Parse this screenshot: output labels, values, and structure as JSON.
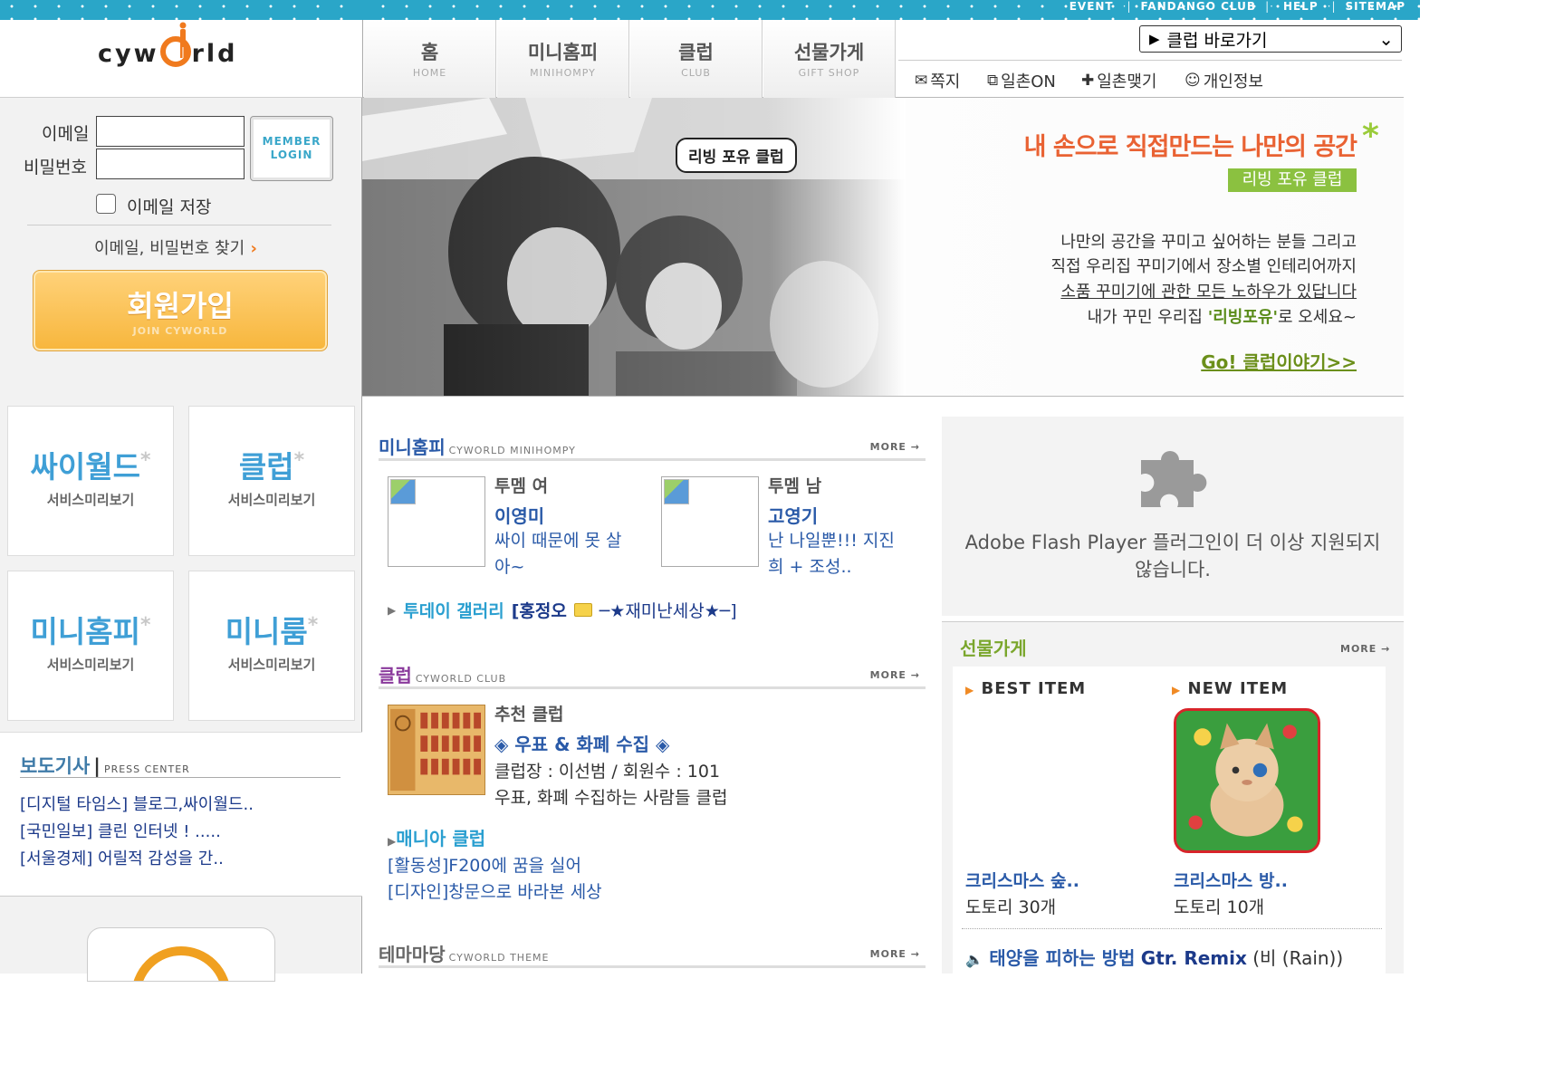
{
  "top_links": [
    "EVENT",
    "FANDANGO CLUB",
    "HELP",
    "SITEMAP"
  ],
  "logo": {
    "text_left": "cyw",
    "text_right": "rld"
  },
  "nav": {
    "tabs": [
      {
        "ko": "홈",
        "en": "HOME"
      },
      {
        "ko": "미니홈피",
        "en": "MINIHOMPY"
      },
      {
        "ko": "클럽",
        "en": "CLUB"
      },
      {
        "ko": "선물가게",
        "en": "GIFT SHOP"
      }
    ],
    "club_select": "클럽 바로가기",
    "sub": [
      "쪽지",
      "일촌ON",
      "일촌맺기",
      "개인정보"
    ]
  },
  "login": {
    "email_label": "이메일",
    "password_label": "비밀번호",
    "member_login": [
      "MEMBER",
      "LOGIN"
    ],
    "save_email": "이메일 저장",
    "find": "이메일, 비밀번호 찾기",
    "join_ko": "회원가입",
    "join_en": "JOIN CYWORLD"
  },
  "hero": {
    "bubble": "리빙 포유 클럽",
    "headline": "내 손으로 직접만드는 나만의 공간",
    "badge": "리빙 포유 클럽",
    "lines": [
      "나만의 공간을 꾸미고 싶어하는 분들 그리고",
      "직접 우리집 꾸미기에서 장소별 인테리어까지",
      "소품 꾸미기에 관한 모든 노하우가 있답니다"
    ],
    "line4_pre": "내가 꾸민 우리집 ",
    "line4_bold": "'리빙포유'",
    "line4_post": "로 오세요~",
    "link": "Go! 클럽이야기>>"
  },
  "tiles": [
    {
      "title": "싸이월드",
      "sub": "서비스미리보기"
    },
    {
      "title": "클럽",
      "sub": "서비스미리보기"
    },
    {
      "title": "미니홈피",
      "sub": "서비스미리보기"
    },
    {
      "title": "미니룸",
      "sub": "서비스미리보기"
    }
  ],
  "press": {
    "title": "보도기사",
    "en": "PRESS CENTER",
    "items": [
      "[디지털 타임스] 블로그,싸이월드..",
      "[국민일보] 클린 인터넷 ! .....",
      "[서울경제] 어릴적 감성을 간.."
    ]
  },
  "minihompy": {
    "title": "미니홈피",
    "en": "CYWORLD MINIHOMPY",
    "more": "MORE",
    "female": {
      "label": "투멤 여",
      "name": "이영미",
      "desc1": "싸이 때문에 못 살",
      "desc2": "아~"
    },
    "male": {
      "label": "투멤 남",
      "name": "고영기",
      "desc1": "난 나일뿐!!! 지진",
      "desc2": "희 + 조성.."
    },
    "gallery_label": "투데이 갤러리",
    "gallery_user": "[홍정오",
    "gallery_title": "─★재미난세상★─]"
  },
  "club": {
    "title": "클럽",
    "en": "CYWORLD CLUB",
    "more": "MORE",
    "rec_label": "추천 클럽",
    "rec_name": "◈ 우표 & 화폐 수집 ◈",
    "rec_info": "클럽장 : 이선범 / 회원수 : 101",
    "rec_desc": "우표, 화폐 수집하는 사람들 클럽",
    "mania_title": "매니아 클럽",
    "mania_items": [
      "[활동성]F200에 꿈을 실어",
      "[디자인]창문으로 바라본 세상"
    ]
  },
  "theme": {
    "title": "테마마당",
    "en": "CYWORLD THEME",
    "more": "MORE"
  },
  "flash": {
    "message": "Adobe Flash Player 플러그인이 더 이상 지원되지 않습니다."
  },
  "gift": {
    "title": "선물가게",
    "more": "MORE",
    "best_label": "BEST ITEM",
    "new_label": "NEW ITEM",
    "best": {
      "name": "크리스마스 숲..",
      "price": "도토리 30개"
    },
    "new": {
      "name": "크리스마스 방..",
      "price": "도토리 10개"
    },
    "music_title": "태양을 피하는 방법",
    "music_remix": "Gtr. Remix",
    "music_artist": "(비 (Rain))"
  },
  "colors": {
    "accent": "#2aa6c8",
    "orange": "#f07a1e",
    "green": "#8bc140",
    "link": "#2a5aa8"
  }
}
